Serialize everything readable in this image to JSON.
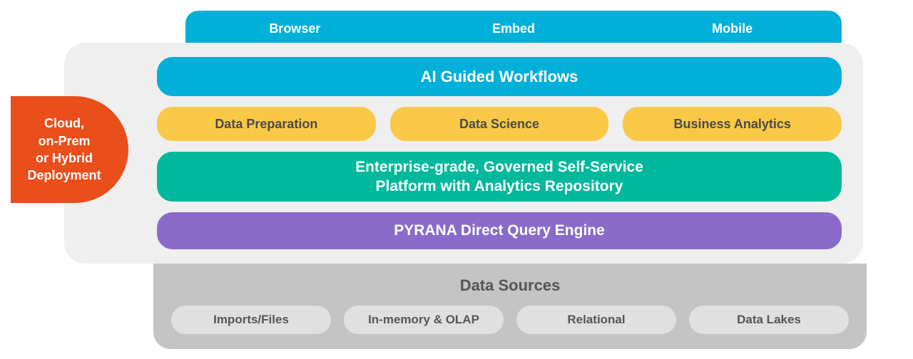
{
  "top_bar": {
    "items": [
      "Browser",
      "Embed",
      "Mobile"
    ]
  },
  "deployment": {
    "label": "Cloud,\non-Prem\nor Hybrid\nDeployment"
  },
  "layers": {
    "ai_workflows": "AI Guided Workflows",
    "capabilities": [
      "Data Preparation",
      "Data Science",
      "Business  Analytics"
    ],
    "platform": "Enterprise-grade, Governed Self-Service\nPlatform with Analytics Repository",
    "query_engine": "PYRANA Direct Query Engine"
  },
  "data_sources": {
    "title": "Data Sources",
    "items": [
      "Imports/Files",
      "In-memory & OLAP",
      "Relational",
      "Data Lakes"
    ]
  },
  "colors": {
    "cyan": "#00b0d8",
    "teal": "#00b89c",
    "purple": "#8b6bc9",
    "yellow": "#f9c846",
    "orange": "#e94e1b",
    "gray_bg": "#efefef",
    "gray_dark": "#c4c4c4",
    "gray_pill": "#e0e0e0"
  }
}
